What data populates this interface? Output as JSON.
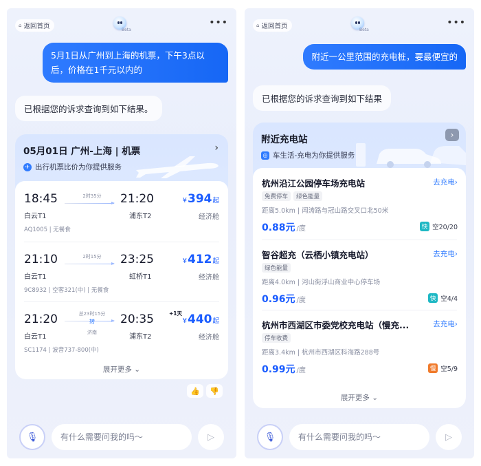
{
  "colors": {
    "accent": "#1a5cff",
    "bubble_user": "#1667f5",
    "fast_badge": "#1fb8c4",
    "slow_badge": "#f07b2c"
  },
  "left": {
    "back_label": "返回首页",
    "logo_badge": "Beta",
    "user_message_lines": [
      "5月1日从广州到上海的机票，下午3点以",
      "后，价格在1千元以内的"
    ],
    "bot_message": "已根据您的诉求查询到如下结果。",
    "card": {
      "title": "05月01日 广州-上海 | 机票",
      "provider": "出行机票比价为你提供服务",
      "flights": [
        {
          "dep_time": "18:45",
          "arr_time": "21:20",
          "dep_airport": "白云T1",
          "arr_airport": "浦东T2",
          "duration": "2时35分",
          "price_currency": "¥",
          "price": "394",
          "price_suffix": "起",
          "cabin": "经济舱",
          "info": "AQ1005 | 无餐食"
        },
        {
          "dep_time": "21:10",
          "arr_time": "23:25",
          "dep_airport": "白云T1",
          "arr_airport": "虹桥T1",
          "duration": "2时15分",
          "price_currency": "¥",
          "price": "412",
          "price_suffix": "起",
          "cabin": "经济舱",
          "info": "9C8932 | 空客321(中) | 无餐食"
        },
        {
          "dep_time": "21:20",
          "arr_time": "20:35",
          "dep_airport": "白云T1",
          "arr_airport": "浦东T2",
          "duration": "总23时15分",
          "stop": "转",
          "stop_city": "济南",
          "next_day": "+1天",
          "price_currency": "¥",
          "price": "440",
          "price_suffix": "起",
          "cabin": "经济舱",
          "info": "SC1174 | 波音737-800(中)"
        }
      ],
      "expand_label": "展开更多"
    },
    "input_placeholder": "有什么需要问我的吗～"
  },
  "right": {
    "back_label": "返回首页",
    "logo_badge": "Beta",
    "user_message": "附近一公里范围的充电桩，要最便宜的",
    "bot_message": "已根据您的诉求查询到如下结果",
    "card": {
      "title": "附近充电站",
      "provider": "车生活-充电为你提供服务",
      "stations": [
        {
          "name": "杭州沿江公园停车场充电站",
          "go": "去充电",
          "tags": [
            "免费停车",
            "绿色能量"
          ],
          "distance": "距离5.0km",
          "address": "闻涛路与冠山路交叉口北50米",
          "price": "0.88元",
          "unit": "/度",
          "badge": "快",
          "availability": "空20/20"
        },
        {
          "name": "智谷超充（云栖小镇充电站）",
          "go": "去充电",
          "tags": [
            "绿色能量"
          ],
          "distance": "距离4.0km",
          "address": "河山街浮山商业中心停车场",
          "price": "0.96元",
          "unit": "/度",
          "badge": "快",
          "availability": "空4/4"
        },
        {
          "name": "杭州市西湖区市委党校充电站（慢充...",
          "go": "去充电",
          "tags": [
            "停车收费"
          ],
          "distance": "距离3.4km",
          "address": "杭州市西湖区科海路288号",
          "price": "0.99元",
          "unit": "/度",
          "badge": "慢",
          "availability": "空5/9"
        }
      ],
      "expand_label": "展开更多"
    },
    "input_placeholder": "有什么需要问我的吗～"
  }
}
